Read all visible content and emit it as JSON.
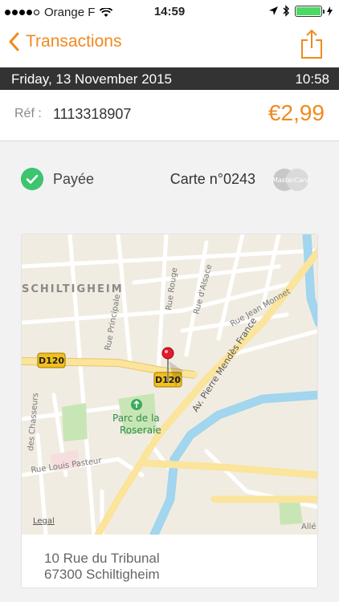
{
  "status_bar": {
    "carrier": "Orange F",
    "time": "14:59",
    "battery_level": 1.0,
    "signal_bars": 4,
    "colors": {
      "battery": "#4cd964"
    }
  },
  "nav": {
    "back_label": "Transactions",
    "accent": "#f08a20",
    "icons": {
      "back": "chevron-left-icon",
      "share": "share-icon"
    }
  },
  "transaction": {
    "date": "Friday, 13 November 2015",
    "time": "10:58",
    "ref_label": "Réf :",
    "ref_value": "1113318907",
    "amount": "€2,99",
    "status": "Payée",
    "card": "Carte n°0243",
    "card_brand": "MasterCard",
    "status_color": "#3cc46f"
  },
  "map": {
    "labels": {
      "city": "SCHILTIGHEIM",
      "road_d120_a": "D120",
      "road_d120_b": "D120",
      "rue_rouge": "Rue Rouge",
      "rue_alsace": "Rue d'Alsace",
      "rue_principale": "Rue Principale",
      "rue_monnet": "Rue Jean Monnet",
      "av_france": "Av. Pierre Mendès France",
      "park_line1": "Parc de la",
      "park_line2": "Roseraie",
      "rue_chasseurs": "des Chasseurs",
      "rue_pasteur": "Rue Louis Pasteur",
      "legal": "Legal",
      "alle": "Allé"
    }
  },
  "address": {
    "line1": "10 Rue du Tribunal",
    "line2": "67300 Schiltigheim"
  }
}
